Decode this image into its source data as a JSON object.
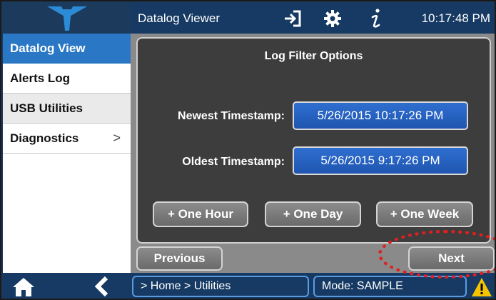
{
  "header": {
    "title": "Datalog Viewer",
    "time": "10:17:48 PM",
    "icons": [
      "teledyne-logo-icon",
      "sign-in-icon",
      "gear-icon",
      "info-icon"
    ]
  },
  "sidebar": {
    "items": [
      {
        "label": "Datalog View",
        "state": "active"
      },
      {
        "label": "Alerts Log"
      },
      {
        "label": "USB Utilities"
      },
      {
        "label": "Diagnostics",
        "chevron": ">"
      }
    ]
  },
  "panel": {
    "title": "Log Filter Options",
    "newest_label": "Newest Timestamp:",
    "newest_value": "5/26/2015 10:17:26 PM",
    "oldest_label": "Oldest Timestamp:",
    "oldest_value": "5/26/2015 9:17:26 PM",
    "buttons": [
      "+ One Hour",
      "+ One Day",
      "+ One Week"
    ]
  },
  "nav": {
    "previous": "Previous",
    "next": "Next"
  },
  "footer": {
    "breadcrumb": "> Home > Utilities",
    "mode": "Mode: SAMPLE",
    "icons": [
      "home-icon",
      "back-icon",
      "warning-icon"
    ]
  },
  "colors": {
    "header_bg": "#163a63",
    "accent_blue": "#2a78c5",
    "annotation": "#e02020",
    "warning": "#f5c400"
  }
}
